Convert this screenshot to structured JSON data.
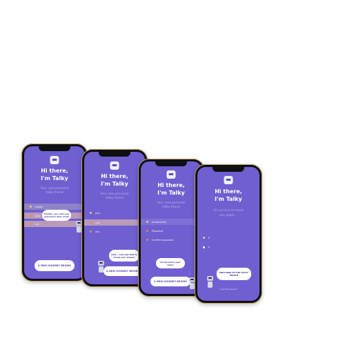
{
  "app_name": "Talky",
  "colors": {
    "screen": "#6f5fd0",
    "accent_light": "#b9b2ee",
    "button_text": "#5a4fb8",
    "chat_highlight": "#8f84c7",
    "chat_pink": "#b99ab9"
  },
  "phones": [
    {
      "greeting_line1": "Hi there,",
      "greeting_line2": "I'm Talky",
      "subtitle_line1": "Your new personal",
      "subtitle_line2": "talky friend",
      "chat_items": [
        "shalah",
        "play",
        "cut"
      ],
      "bubble_text": "Thanks, you can't see someone's face soon!",
      "button_label": "A NEW JOURNEY BEGINS"
    },
    {
      "greeting_line1": "Hi there,",
      "greeting_line2": "I'm Talky",
      "subtitle_line1": "Your new personal",
      "subtitle_line2": "talky friend",
      "chat_items": [
        "pho",
        "sum",
        "yes"
      ],
      "bubble_text": "well... now sad that to check your answer",
      "button_label": "A NEW JOURNEY BEGINS"
    },
    {
      "greeting_line1": "Hi there,",
      "greeting_line2": "I'm Talky",
      "subtitle_line1": "Your new personal",
      "subtitle_line2": "talky friend",
      "chat_items": [
        "Introduction",
        "Password",
        "Confirm password"
      ],
      "bubble_text": "let me know your name",
      "button_label": "A NEW JOURNEY BEGINS"
    },
    {
      "greeting_line1": "Hi there,",
      "greeting_line2": "I'm Talky",
      "subtitle_line1": "It's so nice to meet",
      "subtitle_line2": "you again...",
      "chat_items": [
        "E",
        "P"
      ],
      "bubble_text": "WELCOME TO THE TALKY WORLD",
      "footer_text": "Forgot the password"
    }
  ]
}
